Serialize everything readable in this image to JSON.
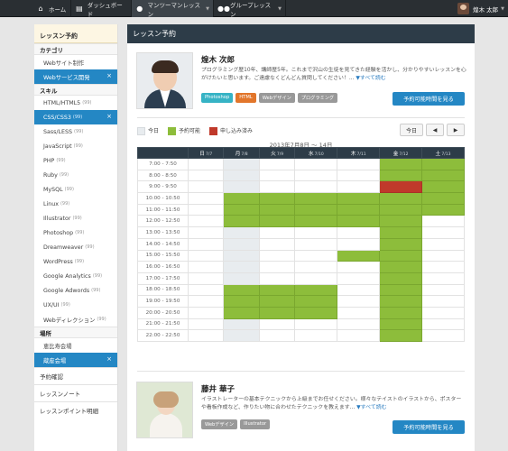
{
  "nav": {
    "items": [
      {
        "label": "ホーム",
        "icon": "home-icon"
      },
      {
        "label": "ダッシュボード",
        "icon": "dashboard-icon"
      },
      {
        "label": "マンツーマンレッスン",
        "icon": "person-icon"
      },
      {
        "label": "グループレッスン",
        "icon": "group-icon"
      }
    ],
    "user_name": "煌木 太郎"
  },
  "sidebar": {
    "title": "レッスン予約",
    "category_heading": "カテゴリ",
    "categories": [
      {
        "label": "Webサイト制作"
      },
      {
        "label": "Webサービス開発",
        "selected": true
      }
    ],
    "skill_heading": "スキル",
    "skills": [
      {
        "label": "HTML/HTML5",
        "count": "(99)"
      },
      {
        "label": "CSS/CSS3",
        "count": "(99)",
        "selected": true
      },
      {
        "label": "Sass/LESS",
        "count": "(99)"
      },
      {
        "label": "JavaScript",
        "count": "(99)"
      },
      {
        "label": "PHP",
        "count": "(99)"
      },
      {
        "label": "Ruby",
        "count": "(99)"
      },
      {
        "label": "MySQL",
        "count": "(99)"
      },
      {
        "label": "Linux",
        "count": "(99)"
      },
      {
        "label": "Illustrator",
        "count": "(99)"
      },
      {
        "label": "Photoshop",
        "count": "(99)"
      },
      {
        "label": "Dreamweaver",
        "count": "(99)"
      },
      {
        "label": "WordPress",
        "count": "(99)"
      },
      {
        "label": "Google Analytics",
        "count": "(99)"
      },
      {
        "label": "Google Adwords",
        "count": "(99)"
      },
      {
        "label": "UX/UI",
        "count": "(99)"
      },
      {
        "label": "Webディレクション",
        "count": "(99)"
      }
    ],
    "place_heading": "場所",
    "places": [
      {
        "label": "恵比寿会場"
      },
      {
        "label": "蔵座会場",
        "selected": true
      }
    ],
    "links": [
      "予約確認",
      "レッスンノート",
      "レッスンポイント明細"
    ],
    "remove_glyph": "×"
  },
  "main": {
    "title": "レッスン予約",
    "teachers": [
      {
        "name": "煌木 次郎",
        "desc": "プログラミング歴10年、講師歴5年。これまで沢山の生徒を見てきた経験を活かし、分かりやすいレッスンを心がけたいと思います。ご遠慮なくどんどん質問してください！...",
        "more": "▼すべて読む",
        "tags": [
          "Photoshop",
          "HTML",
          "Webデザイン",
          "プログラミング"
        ],
        "button": "予約可能時間を見る"
      },
      {
        "name": "藤井 華子",
        "desc": "イラストレーターの基本テクニックから上級までお任せください。様々なテイストのイラストから、ポスターや看板作成など、作りたい物に合わせたテクニックを教えます...",
        "more": "▼すべて読む",
        "tags": [
          "Webデザイン",
          "Illustrator"
        ],
        "button": "予約可能時間を見る"
      }
    ],
    "legend": {
      "today": "今日",
      "available": "予約可能",
      "booked": "申し込み済み"
    },
    "controls": {
      "today": "今日",
      "prev": "◀",
      "next": "▶"
    },
    "week_label": "2013年7月8日 〜 14日",
    "days": [
      {
        "d": "日",
        "n": "7/7"
      },
      {
        "d": "月",
        "n": "7/8"
      },
      {
        "d": "火",
        "n": "7/9"
      },
      {
        "d": "水",
        "n": "7/10"
      },
      {
        "d": "木",
        "n": "7/11"
      },
      {
        "d": "金",
        "n": "7/12"
      },
      {
        "d": "土",
        "n": "7/13"
      }
    ],
    "slots": [
      {
        "time": "7:00 - 7:50",
        "cells": [
          0,
          0,
          0,
          0,
          0,
          1,
          1
        ]
      },
      {
        "time": "8:00 - 8:50",
        "cells": [
          0,
          0,
          0,
          0,
          0,
          1,
          1
        ]
      },
      {
        "time": "9:00 - 9:50",
        "cells": [
          0,
          0,
          0,
          0,
          0,
          2,
          1
        ]
      },
      {
        "time": "10:00 - 10:50",
        "cells": [
          0,
          1,
          1,
          1,
          1,
          1,
          1
        ]
      },
      {
        "time": "11:00 - 11:50",
        "cells": [
          0,
          1,
          1,
          1,
          1,
          1,
          1
        ]
      },
      {
        "time": "12:00 - 12:50",
        "cells": [
          0,
          1,
          1,
          1,
          1,
          1,
          0
        ]
      },
      {
        "time": "13:00 - 13:50",
        "cells": [
          0,
          0,
          0,
          0,
          0,
          1,
          0
        ]
      },
      {
        "time": "14:00 - 14:50",
        "cells": [
          0,
          0,
          0,
          0,
          0,
          1,
          0
        ]
      },
      {
        "time": "15:00 - 15:50",
        "cells": [
          0,
          0,
          0,
          0,
          1,
          1,
          0
        ]
      },
      {
        "time": "16:00 - 16:50",
        "cells": [
          0,
          0,
          0,
          0,
          0,
          1,
          0
        ]
      },
      {
        "time": "17:00 - 17:50",
        "cells": [
          0,
          0,
          0,
          0,
          0,
          1,
          0
        ]
      },
      {
        "time": "18:00 - 18:50",
        "cells": [
          0,
          1,
          1,
          1,
          0,
          1,
          0
        ]
      },
      {
        "time": "19:00 - 19:50",
        "cells": [
          0,
          1,
          1,
          1,
          0,
          1,
          0
        ]
      },
      {
        "time": "20:00 - 20:50",
        "cells": [
          0,
          1,
          1,
          1,
          0,
          1,
          0
        ]
      },
      {
        "time": "21:00 - 21:50",
        "cells": [
          0,
          0,
          0,
          0,
          0,
          1,
          0
        ]
      },
      {
        "time": "22:00 - 22:50",
        "cells": [
          0,
          0,
          0,
          0,
          0,
          1,
          0
        ]
      }
    ],
    "today_index": 1
  },
  "colors": {
    "available": "#8dbd3b",
    "booked": "#c0392b",
    "today": "#e8ecef",
    "accent": "#2487c4",
    "nav": "#2a2f33"
  }
}
